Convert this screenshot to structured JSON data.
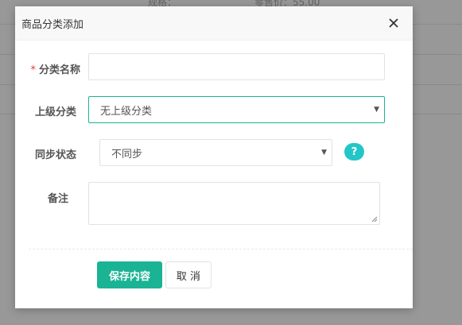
{
  "background": {
    "texts": [
      "规格：",
      "零售价：55.00"
    ]
  },
  "modal": {
    "title": "商品分类添加",
    "fields": {
      "category_name": {
        "required_mark": "*",
        "label": "分类名称",
        "value": ""
      },
      "parent_category": {
        "label": "上级分类",
        "selected": "无上级分类"
      },
      "sync_status": {
        "label": "同步状态",
        "selected": "不同步",
        "help": "?"
      },
      "remark": {
        "label": "备注",
        "value": ""
      }
    },
    "buttons": {
      "save": "保存内容",
      "cancel": "取 消"
    }
  },
  "colors": {
    "primary": "#1ab394",
    "help": "#23c6c8",
    "required": "#e4393c"
  },
  "icons": {
    "close": "close-icon",
    "dropdown": "chevron-down-icon",
    "help": "question-icon"
  }
}
